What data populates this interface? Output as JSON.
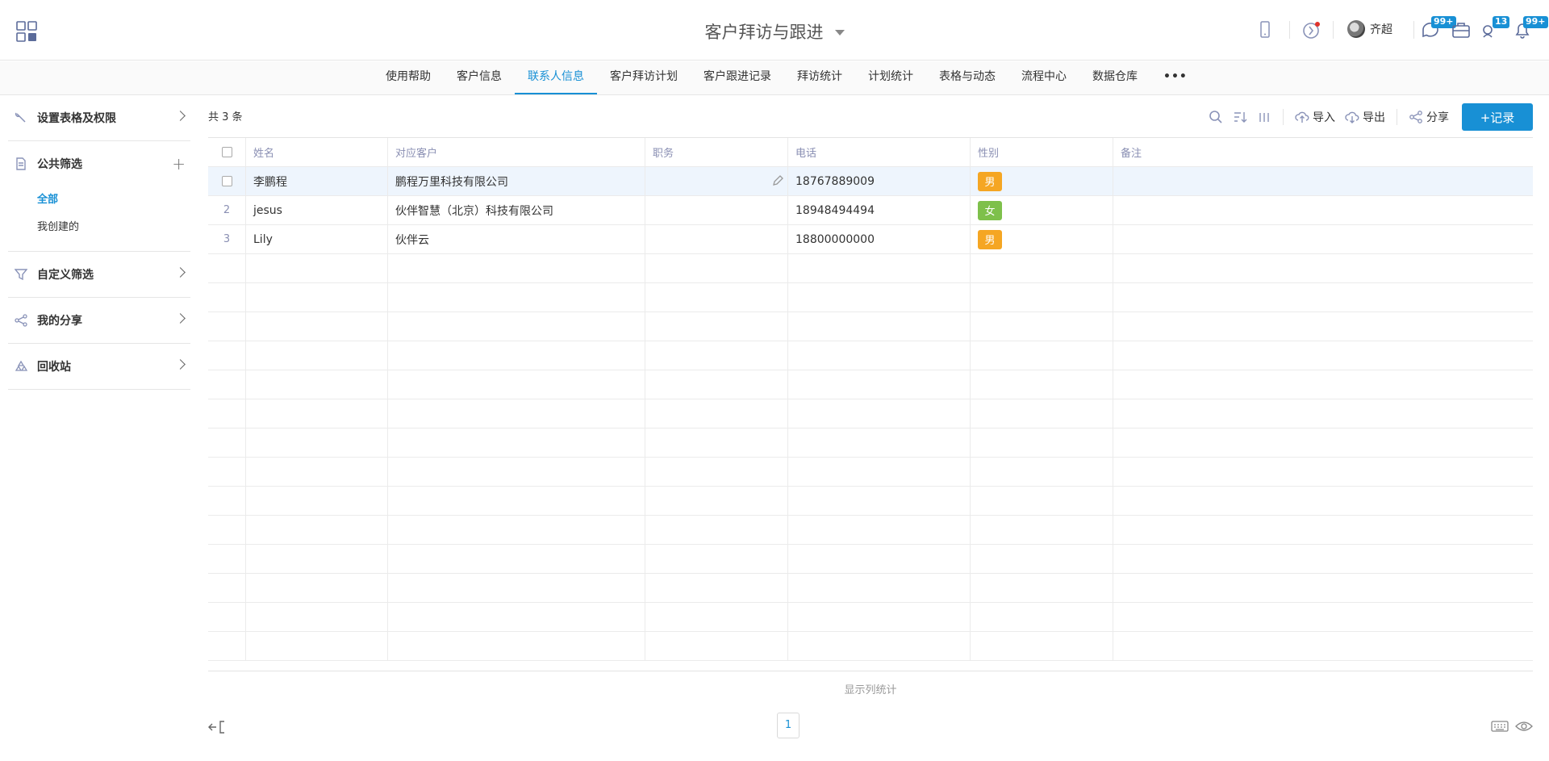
{
  "header": {
    "title": "客户拜访与跟进",
    "user_name": "齐超",
    "badges": {
      "messages": "99+",
      "tasks": "13",
      "notifications": "99+"
    }
  },
  "nav": {
    "tabs": [
      {
        "label": "使用帮助"
      },
      {
        "label": "客户信息"
      },
      {
        "label": "联系人信息"
      },
      {
        "label": "客户拜访计划"
      },
      {
        "label": "客户跟进记录"
      },
      {
        "label": "拜访统计"
      },
      {
        "label": "计划统计"
      },
      {
        "label": "表格与动态"
      },
      {
        "label": "流程中心"
      },
      {
        "label": "数据仓库"
      }
    ],
    "more": "•••"
  },
  "sidebar": {
    "settings": "设置表格及权限",
    "public_filter": "公共筛选",
    "sub_items": [
      "全部",
      "我创建的"
    ],
    "custom_filter": "自定义筛选",
    "my_share": "我的分享",
    "recycle": "回收站"
  },
  "toolbar": {
    "count": "共 3 条",
    "import": "导入",
    "export": "导出",
    "share": "分享",
    "add_record": "+记录"
  },
  "table": {
    "columns": [
      "姓名",
      "对应客户",
      "职务",
      "电话",
      "性别",
      "备注"
    ],
    "rows": [
      {
        "index": "",
        "name": "李鹏程",
        "customer": "鹏程万里科技有限公司",
        "title": "",
        "phone": "18767889009",
        "gender": "男",
        "note": ""
      },
      {
        "index": "2",
        "name": "jesus",
        "customer": "伙伴智慧（北京）科技有限公司",
        "title": "",
        "phone": "18948494494",
        "gender": "女",
        "note": ""
      },
      {
        "index": "3",
        "name": "Lily",
        "customer": "伙伴云",
        "title": "",
        "phone": "18800000000",
        "gender": "男",
        "note": ""
      }
    ],
    "gender_colors": {
      "男": "#f5a623",
      "女": "#7ec04b"
    }
  },
  "footer": {
    "stats": "显示列统计",
    "page": "1"
  }
}
